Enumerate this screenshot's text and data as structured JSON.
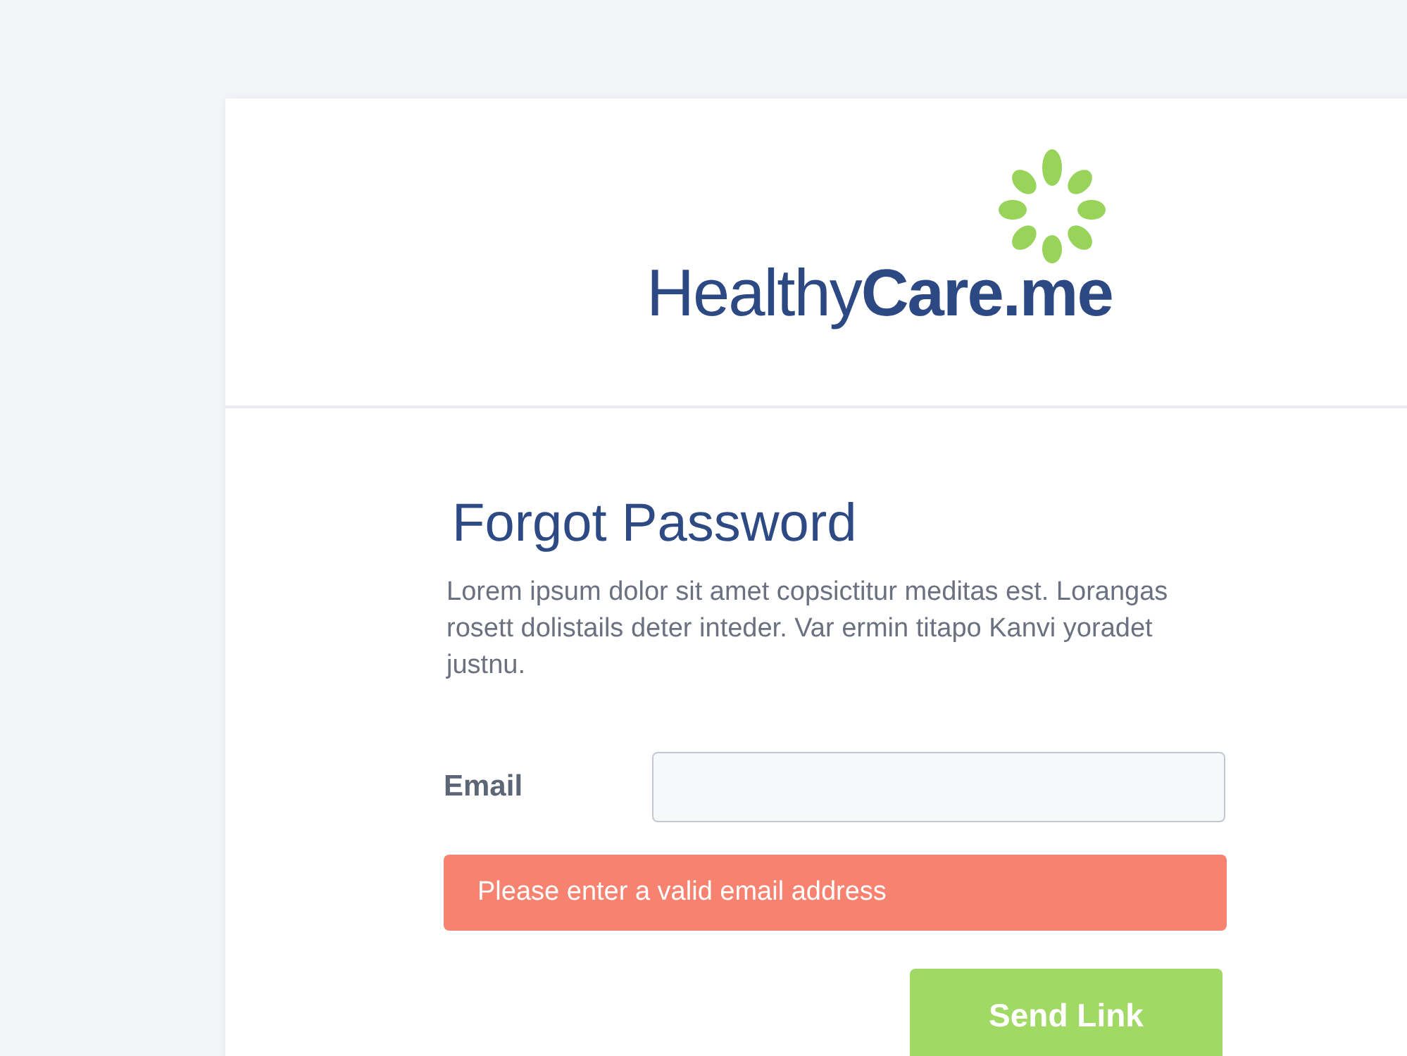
{
  "logo": {
    "text": "Healthy**Care.me**"
  },
  "form": {
    "title": "Forgot Password",
    "description": "Lorem ipsum dolor sit amet copsictitur meditas est. Lorangas rosett dolistails deter inteder. Var ermin titapo Kanvi yoradet justnu.",
    "email_label": "Email",
    "error": "Please enter a valid email address",
    "submit": "Send Link"
  }
}
